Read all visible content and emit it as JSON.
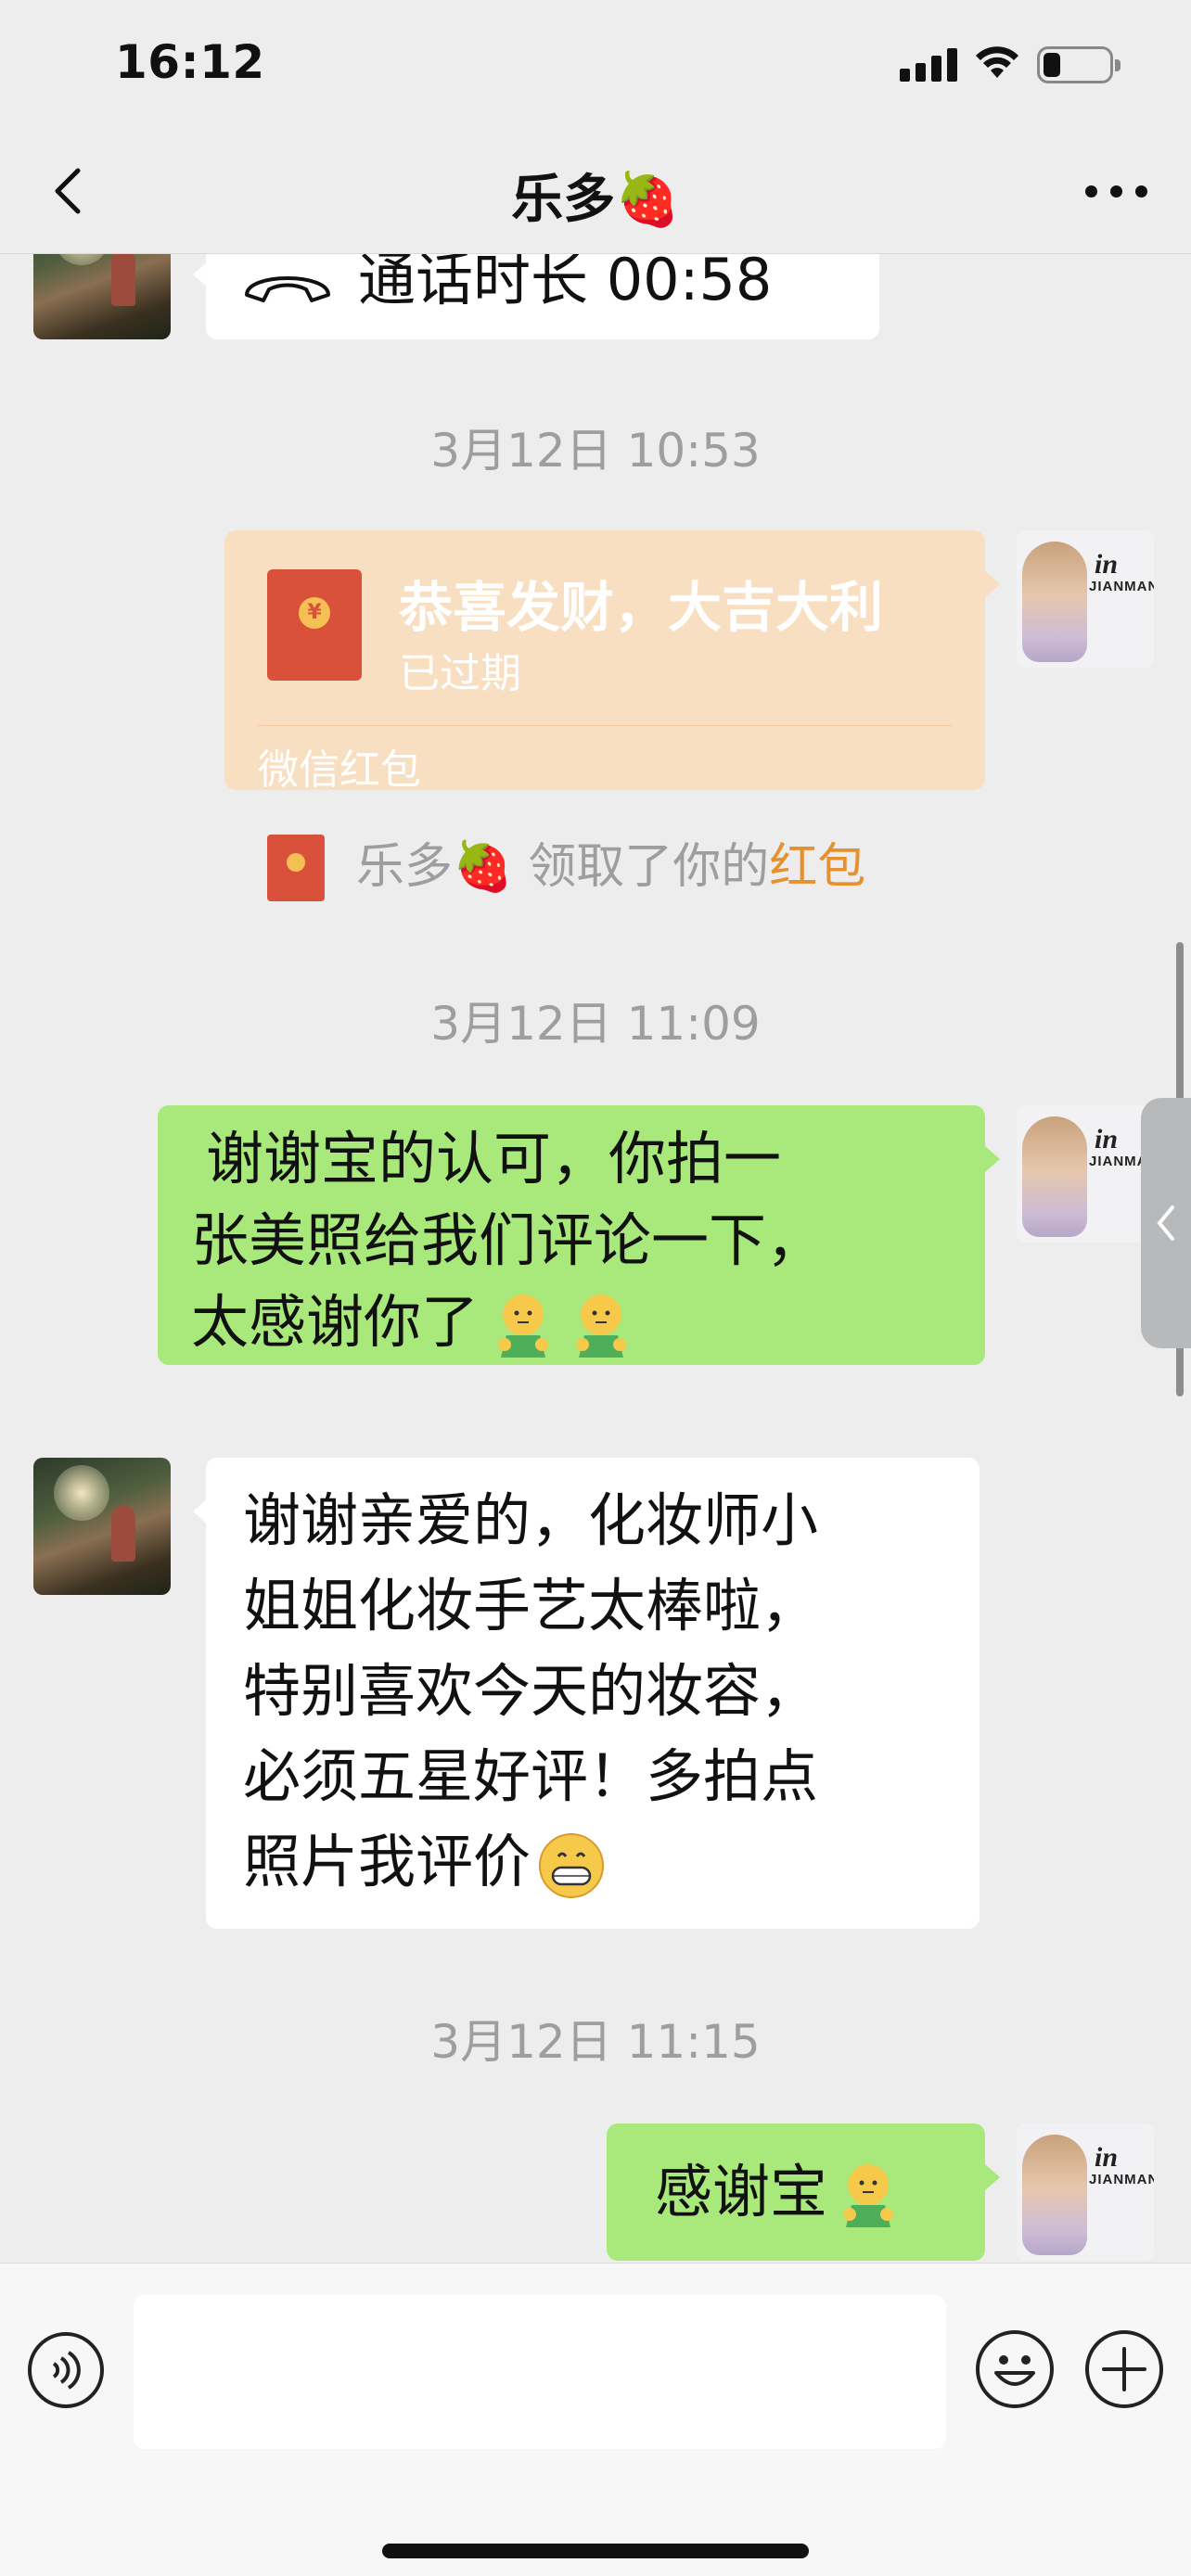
{
  "status_bar": {
    "time": "16:12"
  },
  "nav": {
    "title": "乐多🍓"
  },
  "messages": {
    "call": {
      "text": "通话时长 00:58"
    },
    "ts1": "3月12日 10:53",
    "red_packet": {
      "title": "恭喜发财，大吉大利",
      "status": "已过期",
      "footer": "微信红包",
      "coin": "¥"
    },
    "system": {
      "prefix": "乐多🍓 领取了你的",
      "link": "红包"
    },
    "ts2": "3月12日 11:09",
    "msg_out_1": {
      "lines": [
        "谢谢宝的认可，你拍一",
        "张美照给我们评论一下，",
        "太感谢你了"
      ]
    },
    "msg_in_1": {
      "lines": [
        "谢谢亲爱的，化妆师小",
        "姐姐化妆手艺太棒啦，",
        "特别喜欢今天的妆容，",
        "必须五星好评！多拍点",
        "照片我评价"
      ]
    },
    "ts3": "3月12日 11:15",
    "msg_out_2": {
      "text": "感谢宝"
    },
    "my_avatar_logo": "JIANMAN"
  },
  "colors": {
    "background": "#ededed",
    "green_bubble": "#a9e97b",
    "red_packet": "#f8dfc2",
    "link_orange": "#e6912f"
  }
}
